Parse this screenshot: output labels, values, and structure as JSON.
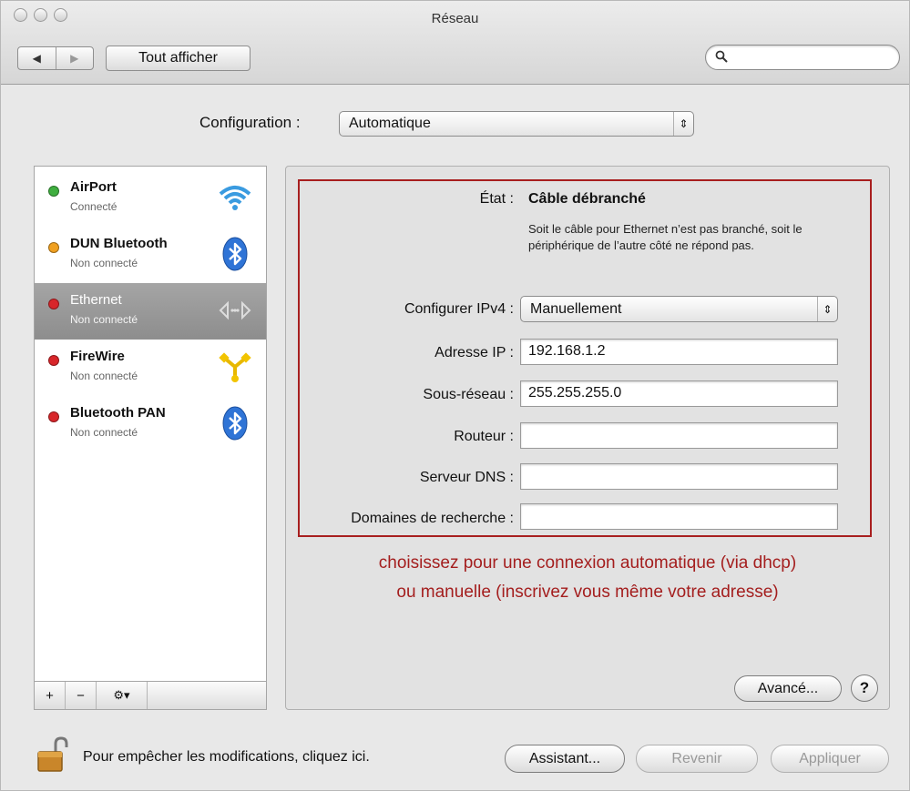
{
  "window": {
    "title": "Réseau",
    "back_glyph": "◀",
    "forward_glyph": "▶",
    "show_all_label": "Tout afficher",
    "search_placeholder": ""
  },
  "configuration": {
    "label": "Configuration :",
    "value": "Automatique"
  },
  "services": [
    {
      "name": "AirPort",
      "status": "Connecté",
      "dot_color": "#3fae3f",
      "icon": "wifi-icon"
    },
    {
      "name": "DUN Bluetooth",
      "status": "Non connecté",
      "dot_color": "#f0a020",
      "icon": "bluetooth-icon"
    },
    {
      "name": "Ethernet",
      "status": "Non connecté",
      "dot_color": "#d8262a",
      "icon": "ethernet-icon",
      "selected": true
    },
    {
      "name": "FireWire",
      "status": "Non connecté",
      "dot_color": "#d8262a",
      "icon": "firewire-icon"
    },
    {
      "name": "Bluetooth PAN",
      "status": "Non connecté",
      "dot_color": "#d8262a",
      "icon": "bluetooth-icon"
    }
  ],
  "sidebar_buttons": {
    "add": "+",
    "remove": "−",
    "action": "⚙▾"
  },
  "detail": {
    "etat_label": "État :",
    "etat_value": "Câble débranché",
    "etat_description": "Soit le câble pour Ethernet n’est pas branché, soit le périphérique de l’autre côté ne répond pas.",
    "ipv4_label": "Configurer IPv4 :",
    "ipv4_value": "Manuellement",
    "ip_label": "Adresse IP :",
    "ip_value": "192.168.1.2",
    "subnet_label": "Sous-réseau :",
    "subnet_value": "255.255.255.0",
    "router_label": "Routeur :",
    "router_value": "",
    "dns_label": "Serveur DNS :",
    "dns_value": "",
    "search_domains_label": "Domaines de recherche :",
    "search_domains_value": ""
  },
  "annotation": {
    "line1": "choisissez pour une connexion automatique (via dhcp)",
    "line2": "ou manuelle (inscrivez vous même votre adresse)"
  },
  "buttons": {
    "advanced": "Avancé...",
    "help": "?",
    "assistant": "Assistant...",
    "revert": "Revenir",
    "apply": "Appliquer"
  },
  "lock_text": "Pour empêcher les modifications, cliquez ici.",
  "colors": {
    "annotation_red": "#a41e1e",
    "selection_gray": "#989898",
    "bluetooth_blue": "#2f74d6"
  }
}
